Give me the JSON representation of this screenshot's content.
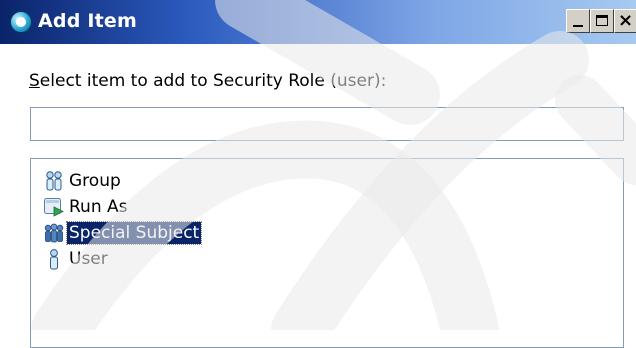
{
  "window": {
    "title": "Add Item",
    "icons": {
      "app": "eclipse-circle-icon",
      "minimize": "minimize-icon",
      "maximize": "maximize-icon",
      "close": "close-icon"
    },
    "close_glyph": "×"
  },
  "dialog": {
    "prompt_accel": "S",
    "prompt_rest": "elect item to add to Security Role (user):",
    "search": {
      "value": "",
      "placeholder": ""
    },
    "items": [
      {
        "label": "Group",
        "icon": "group-icon",
        "selected": false
      },
      {
        "label": "Run As",
        "icon": "run-as-icon",
        "selected": false
      },
      {
        "label": "Special Subject",
        "icon": "special-subject-icon",
        "selected": true
      },
      {
        "label": "User",
        "icon": "user-icon",
        "selected": false
      }
    ]
  },
  "colors": {
    "title_start": "#0a246a",
    "title_end": "#a6caf0",
    "selection": "#0a246a",
    "border": "#7f9db9",
    "button_face": "#d4d0c8"
  }
}
